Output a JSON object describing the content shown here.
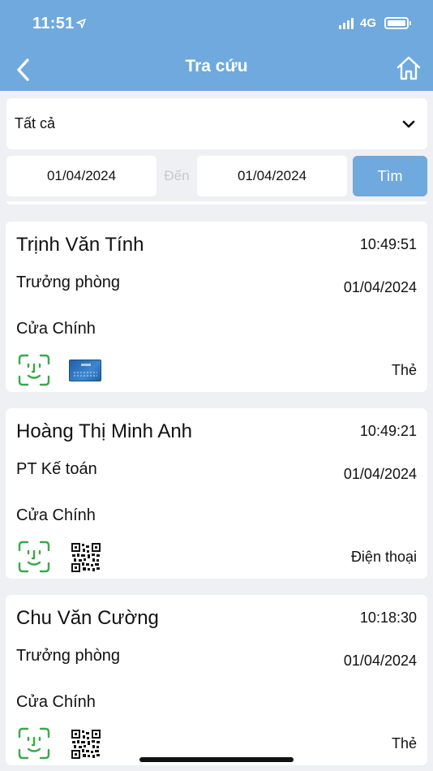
{
  "status_bar": {
    "time": "11:51",
    "network": "4G"
  },
  "header": {
    "title": "Tra cứu"
  },
  "filter": {
    "selected": "Tất cả"
  },
  "date_range": {
    "from": "01/04/2024",
    "separator": "Đến",
    "to": "01/04/2024",
    "search_label": "Tìm"
  },
  "colors": {
    "header": "#6fa9dd",
    "face_icon": "#3aa84a"
  },
  "records": [
    {
      "name": "Trịnh Văn Tính",
      "time": "10:49:51",
      "role": "Trưởng phòng",
      "date": "01/04/2024",
      "door": "Cửa Chính",
      "method_icon": "card-icon",
      "method": "Thẻ"
    },
    {
      "name": "Hoàng Thị Minh Anh",
      "time": "10:49:21",
      "role": "PT Kế toán",
      "date": "01/04/2024",
      "door": "Cửa Chính",
      "method_icon": "qr-code-icon",
      "method": "Điện thoại"
    },
    {
      "name": "Chu Văn Cường",
      "time": "10:18:30",
      "role": "Trưởng phòng",
      "date": "01/04/2024",
      "door": "Cửa Chính",
      "method_icon": "qr-code-icon",
      "method": "Thẻ"
    }
  ]
}
